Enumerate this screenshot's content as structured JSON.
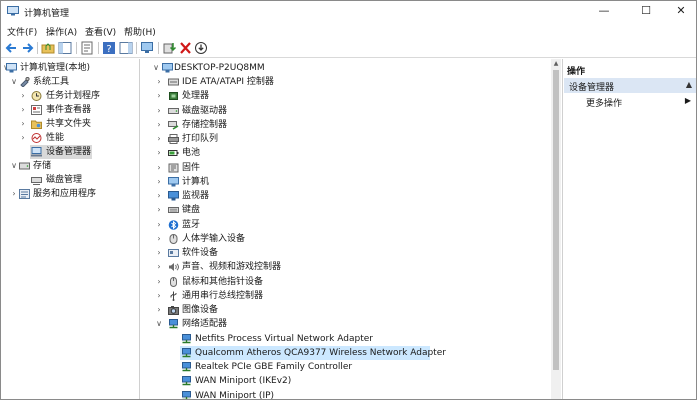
{
  "window": {
    "title": "计算机管理",
    "minimize": "—",
    "maximize": "☐",
    "close": "✕"
  },
  "menu": [
    "文件(F)",
    "操作(A)",
    "查看(V)",
    "帮助(H)"
  ],
  "left_tree": [
    {
      "label": "计算机管理(本地)",
      "chevron": "∨",
      "icon": "computer-management-icon"
    },
    {
      "label": "系统工具",
      "chevron": "∨",
      "icon": "system-tools-icon"
    },
    {
      "label": "任务计划程序",
      "chevron": "›",
      "icon": "task-scheduler-icon"
    },
    {
      "label": "事件查看器",
      "chevron": "›",
      "icon": "event-viewer-icon"
    },
    {
      "label": "共享文件夹",
      "chevron": "›",
      "icon": "shared-folders-icon"
    },
    {
      "label": "性能",
      "chevron": "›",
      "icon": "performance-icon"
    },
    {
      "label": "设备管理器",
      "chevron": "",
      "icon": "device-manager-icon"
    },
    {
      "label": "存储",
      "chevron": "∨",
      "icon": "storage-icon"
    },
    {
      "label": "磁盘管理",
      "chevron": "",
      "icon": "disk-management-icon"
    },
    {
      "label": "服务和应用程序",
      "chevron": "›",
      "icon": "services-apps-icon"
    }
  ],
  "device_tree": {
    "root": "DESKTOP-P2UQ8MM",
    "categories": [
      {
        "label": "IDE ATA/ATAPI 控制器",
        "chevron": "›",
        "icon": "ide-controller-icon"
      },
      {
        "label": "处理器",
        "chevron": "›",
        "icon": "processor-icon"
      },
      {
        "label": "磁盘驱动器",
        "chevron": "›",
        "icon": "disk-drive-icon"
      },
      {
        "label": "存储控制器",
        "chevron": "›",
        "icon": "storage-controller-icon"
      },
      {
        "label": "打印队列",
        "chevron": "›",
        "icon": "print-queue-icon"
      },
      {
        "label": "电池",
        "chevron": "›",
        "icon": "battery-icon"
      },
      {
        "label": "固件",
        "chevron": "›",
        "icon": "firmware-icon"
      },
      {
        "label": "计算机",
        "chevron": "›",
        "icon": "computer-icon"
      },
      {
        "label": "监视器",
        "chevron": "›",
        "icon": "monitor-icon"
      },
      {
        "label": "键盘",
        "chevron": "›",
        "icon": "keyboard-icon"
      },
      {
        "label": "蓝牙",
        "chevron": "›",
        "icon": "bluetooth-icon"
      },
      {
        "label": "人体学输入设备",
        "chevron": "›",
        "icon": "hid-icon"
      },
      {
        "label": "软件设备",
        "chevron": "›",
        "icon": "software-device-icon"
      },
      {
        "label": "声音、视频和游戏控制器",
        "chevron": "›",
        "icon": "sound-icon"
      },
      {
        "label": "鼠标和其他指针设备",
        "chevron": "›",
        "icon": "mouse-icon"
      },
      {
        "label": "通用串行总线控制器",
        "chevron": "›",
        "icon": "usb-icon"
      },
      {
        "label": "图像设备",
        "chevron": "›",
        "icon": "imaging-device-icon"
      },
      {
        "label": "网络适配器",
        "chevron": "∨",
        "icon": "network-adapter-icon"
      }
    ],
    "network_adapters": [
      "Netfits Process Virtual Network Adapter",
      "Qualcomm Atheros QCA9377 Wireless Network Adapter",
      "Realtek PCIe GBE Family Controller",
      "WAN Miniport (IKEv2)",
      "WAN Miniport (IP)"
    ],
    "selected_adapter_index": 1
  },
  "actions": {
    "title": "操作",
    "section": "设备管理器",
    "section_arrow": "▲",
    "more": "更多操作",
    "more_arrow": "▶"
  },
  "colors": {
    "selection_blue": "#cce8ff",
    "selection_gray": "#d9d9d9",
    "actions_header": "#dbe6f4"
  }
}
